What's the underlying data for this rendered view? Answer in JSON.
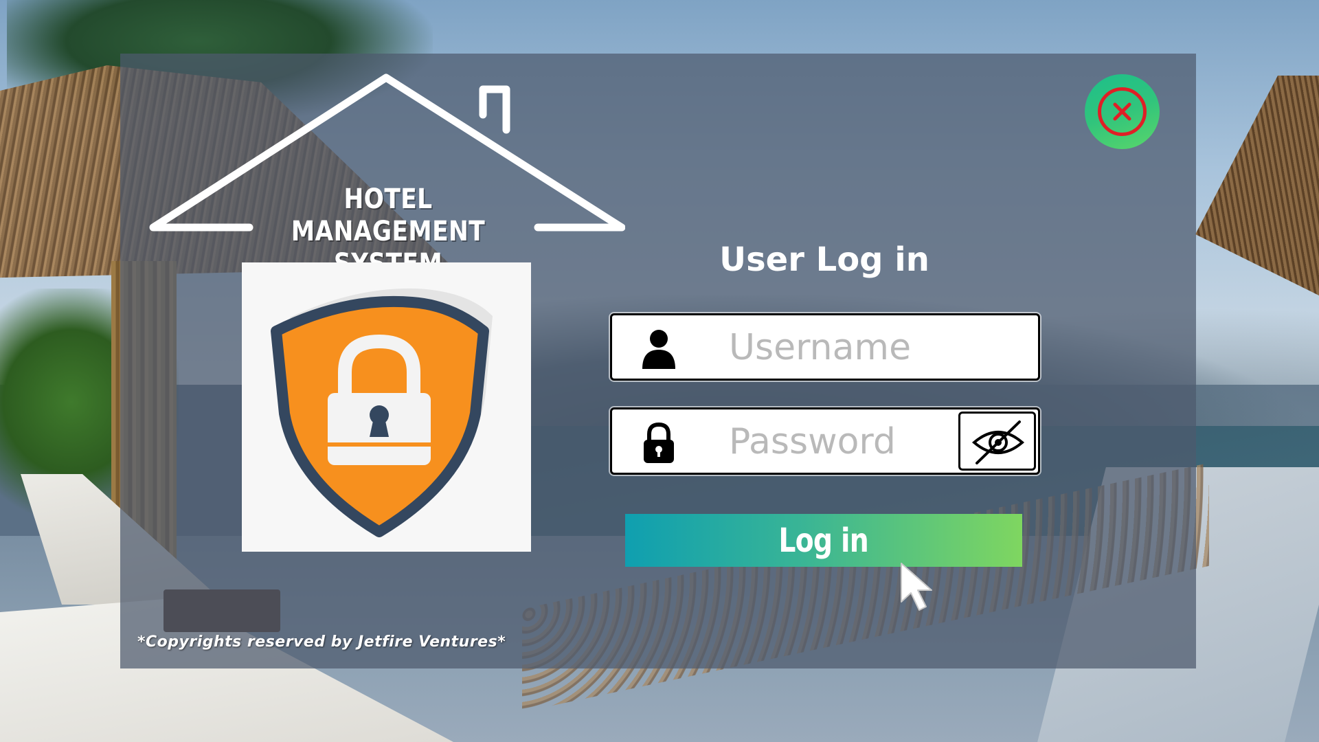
{
  "app": {
    "logo_title_line1": "HOTEL MANAGEMENT",
    "logo_title_line2": "SYSTEM"
  },
  "login": {
    "heading": "User Log in",
    "username_placeholder": "Username",
    "password_placeholder": "Password",
    "submit_label": "Log in"
  },
  "footer": {
    "copyright": "*Copyrights reserved by Jetfire Ventures*"
  },
  "icons": {
    "close": "close-icon",
    "user": "user-icon",
    "lock": "lock-icon",
    "eye_toggle": "eye-slash-icon",
    "shield": "shield-lock-icon",
    "house": "house-outline-icon",
    "cursor": "mouse-cursor-icon"
  },
  "colors": {
    "shield_orange": "#f7901e",
    "shield_border": "#34475f",
    "button_gradient_start": "#0f9fb0",
    "button_gradient_end": "#7fd660",
    "close_ring": "#e01f26",
    "close_bg": "#31c47c"
  }
}
